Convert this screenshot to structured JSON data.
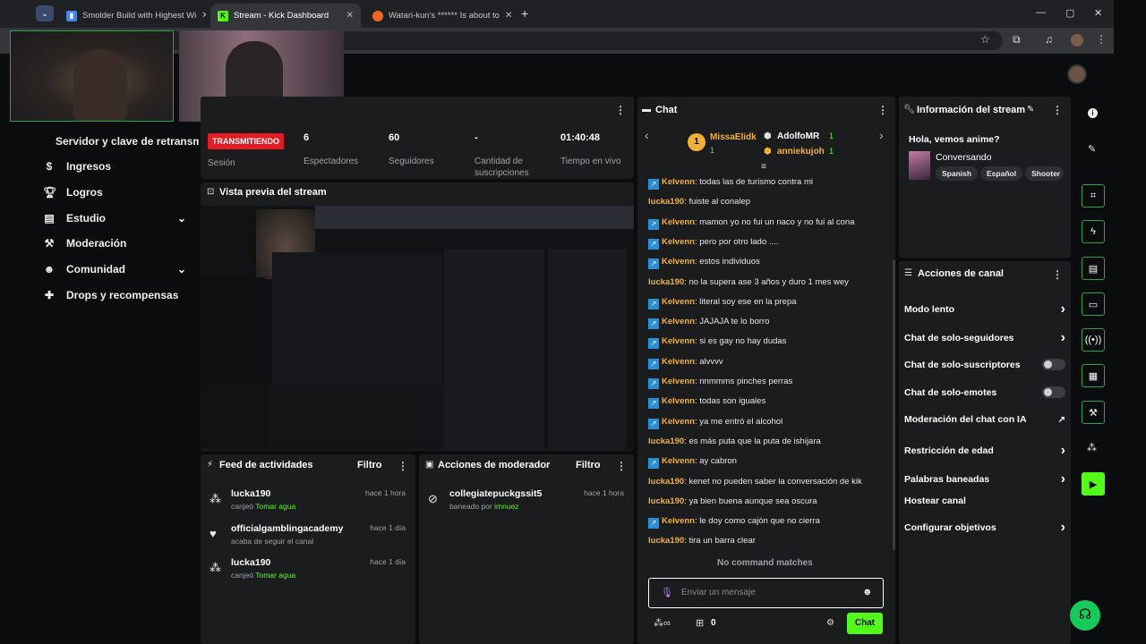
{
  "browser": {
    "tabs": [
      {
        "title": "Smolder Build with Highest Wi",
        "color": "#4285f4"
      },
      {
        "title": "Stream - Kick Dashboard",
        "color": "#53fc18"
      },
      {
        "title": "Watari-kun's ****** Is about to",
        "color": "#f26522"
      }
    ],
    "new_tab": "+"
  },
  "sidebar": {
    "server_key": "Servidor y clave de retransm",
    "items": [
      {
        "label": "Ingresos",
        "icon": "dollar-icon"
      },
      {
        "label": "Logros",
        "icon": "trophy-icon"
      },
      {
        "label": "Estudio",
        "icon": "studio-icon",
        "chevron": true
      },
      {
        "label": "Moderación",
        "icon": "gavel-icon"
      },
      {
        "label": "Comunidad",
        "icon": "community-icon",
        "chevron": true
      },
      {
        "label": "Drops y recompensas",
        "icon": "gift-icon"
      }
    ]
  },
  "session": {
    "status": "TRANSMITIENDO",
    "session_label": "Sesión",
    "stats": [
      {
        "value": "6",
        "label": "Espectadores"
      },
      {
        "value": "60",
        "label": "Seguidores"
      },
      {
        "value": "-",
        "label": "Cantidad de suscripciones"
      },
      {
        "value": "01:40:48",
        "label": "Tiempo en vivo"
      }
    ]
  },
  "preview": {
    "title": "Vista previa del stream"
  },
  "activity": {
    "title": "Feed de actividades",
    "filter": "Filtro",
    "items": [
      {
        "name": "lucka190",
        "action": "canjeó",
        "reward": "Tomar agua",
        "time": "hace 1 hora",
        "icon": "redeem-icon"
      },
      {
        "name": "officialgamblingacademy",
        "action": "acaba de seguir el canal",
        "reward": "",
        "time": "hace 1 día",
        "icon": "heart-icon"
      },
      {
        "name": "lucka190",
        "action": "canjeó",
        "reward": "Tomar agua",
        "time": "hace 1 día",
        "icon": "redeem-icon"
      }
    ]
  },
  "mod_actions": {
    "title": "Acciones de moderador",
    "filter": "Filtro",
    "items": [
      {
        "name": "collegiatepuckgssit5",
        "action": "baneado por",
        "by": "imnuez",
        "time": "hace 1 hora"
      }
    ]
  },
  "chat": {
    "title": "Chat",
    "leaders": [
      {
        "rank": "1",
        "name": "MissaElidk",
        "count": "1"
      },
      {
        "name": "AdolfoMR",
        "count": "1"
      },
      {
        "name": "anniekujoh",
        "count": "1"
      }
    ],
    "messages": [
      {
        "user": "Kelvenn",
        "kick": true,
        "color": "#f2b134",
        "text": "todas las de turismo contra mi"
      },
      {
        "user": "lucka190",
        "kick": false,
        "color": "#f2b134",
        "text": "fuiste al conalep"
      },
      {
        "user": "Kelvenn",
        "kick": true,
        "color": "#f2b134",
        "text": "mamon yo no fui un naco y no fui al cona"
      },
      {
        "user": "Kelvenn",
        "kick": true,
        "color": "#f2b134",
        "text": "pero por otro lado ...."
      },
      {
        "user": "Kelvenn",
        "kick": true,
        "color": "#f2b134",
        "text": "estos individuos"
      },
      {
        "user": "lucka190",
        "kick": false,
        "color": "#f2b134",
        "text": "no la supera ase 3 años y duro 1 mes wey"
      },
      {
        "user": "Kelvenn",
        "kick": true,
        "color": "#f2b134",
        "text": "literal soy ese en la prepa"
      },
      {
        "user": "Kelvenn",
        "kick": true,
        "color": "#f2b134",
        "text": "JAJAJA te lo borro"
      },
      {
        "user": "Kelvenn",
        "kick": true,
        "color": "#f2b134",
        "text": "si es gay no hay dudas"
      },
      {
        "user": "Kelvenn",
        "kick": true,
        "color": "#f2b134",
        "text": "alvvvv"
      },
      {
        "user": "Kelvenn",
        "kick": true,
        "color": "#f2b134",
        "text": "nnmmms pinches perras"
      },
      {
        "user": "Kelvenn",
        "kick": true,
        "color": "#f2b134",
        "text": "todas son iguales"
      },
      {
        "user": "Kelvenn",
        "kick": true,
        "color": "#f2b134",
        "text": "ya me entró el alcohol"
      },
      {
        "user": "lucka190",
        "kick": false,
        "color": "#f2b134",
        "text": "es más puta que la puta de ishijara"
      },
      {
        "user": "Kelvenn",
        "kick": true,
        "color": "#f2b134",
        "text": "ay cabron"
      },
      {
        "user": "lucka190",
        "kick": false,
        "color": "#f2b134",
        "text": "kenet no pueden saber la conversación de kik"
      },
      {
        "user": "lucka190",
        "kick": false,
        "color": "#f2b134",
        "text": "ya bien buena aunque sea oscura"
      },
      {
        "user": "Kelvenn",
        "kick": true,
        "color": "#f2b134",
        "text": "le doy como cajón que no cierra"
      },
      {
        "user": "lucka190",
        "kick": false,
        "color": "#f2b134",
        "text": "tira un barra clear"
      }
    ],
    "no_matches": "No command matches",
    "input_placeholder": "Enviar un mensaje",
    "points": "0",
    "send_label": "Chat"
  },
  "stream_info": {
    "title": "Información del stream",
    "stream_title": "Hola, vemos anime?",
    "category": "Conversando",
    "tags": [
      "Spanish",
      "Español",
      "Shooter"
    ]
  },
  "channel_actions": {
    "title": "Acciones de canal",
    "items": [
      {
        "label": "Modo lento",
        "control": "chevron"
      },
      {
        "label": "Chat de solo-seguidores",
        "control": "chevron"
      },
      {
        "label": "Chat de solo-suscriptores",
        "control": "toggle"
      },
      {
        "label": "Chat de solo-emotes",
        "control": "toggle"
      },
      {
        "label": "Moderación del chat con IA",
        "control": "external"
      },
      {
        "label": "Restricción de edad",
        "control": "chevron"
      },
      {
        "label": "Palabras baneadas",
        "control": "chevron"
      },
      {
        "label": "Hostear canal",
        "control": "none"
      },
      {
        "label": "Configurar objetivos",
        "control": "chevron"
      }
    ]
  },
  "colors": {
    "brand": "#53fc18",
    "live": "#e31b23",
    "panel": "#1a1c1e"
  }
}
